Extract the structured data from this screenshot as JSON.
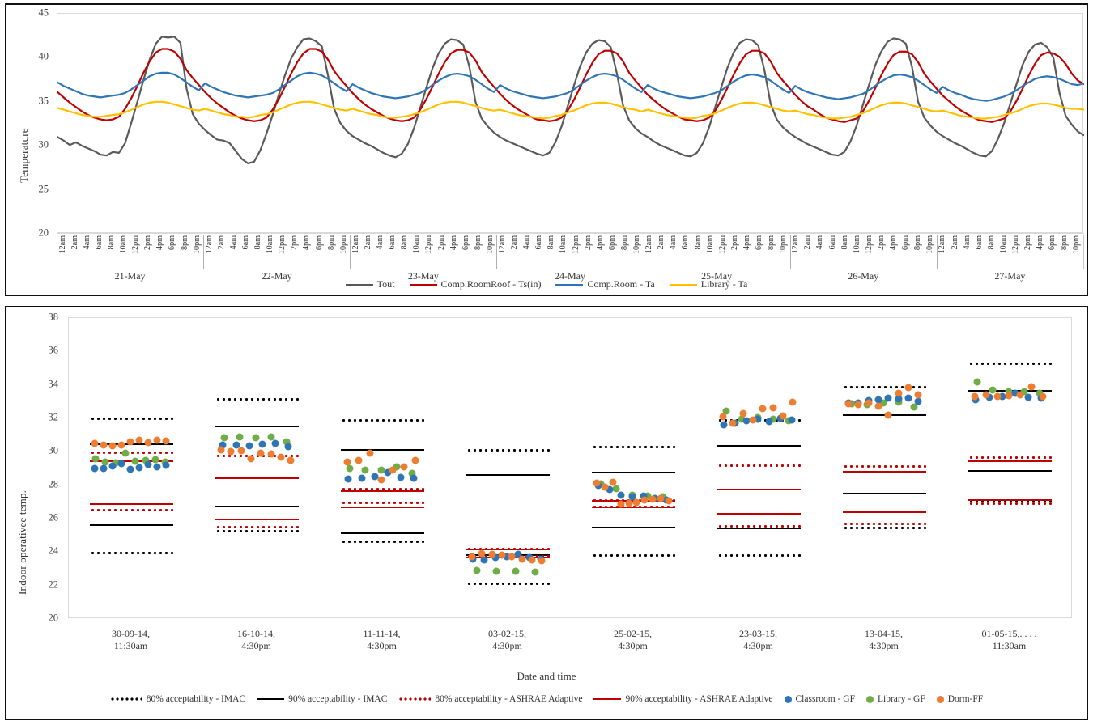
{
  "colors": {
    "tout": "#595959",
    "comp_roomroof": "#C00000",
    "comp_room": "#2E75B6",
    "library": "#FFC000",
    "classroom_gf": "#2E75B6",
    "library_gf": "#70AD47",
    "dorm_ff": "#ED7D31",
    "imac_black": "#000000",
    "ashrae_red": "#C00000",
    "axis": "#d9d9d9"
  },
  "top_chart": {
    "type": "line",
    "ylabel": "Temperature",
    "ylim": [
      20,
      45
    ],
    "yticks": [
      20,
      25,
      30,
      35,
      40,
      45
    ],
    "hour_labels": [
      "12am",
      "2am",
      "4am",
      "6am",
      "8am",
      "10am",
      "12pm",
      "2pm",
      "4pm",
      "6pm",
      "8pm",
      "10pm"
    ],
    "day_labels": [
      "21-May",
      "22-May",
      "23-May",
      "24-May",
      "25-May",
      "26-May",
      "27-May"
    ],
    "legend": [
      {
        "label": "Tout",
        "color": "#595959",
        "style": "solid"
      },
      {
        "label": "Comp.RoomRoof - Ts(in)",
        "color": "#C00000",
        "style": "solid"
      },
      {
        "label": "Comp.Room - Ta",
        "color": "#2E75B6",
        "style": "solid"
      },
      {
        "label": "Library - Ta",
        "color": "#FFC000",
        "style": "solid"
      }
    ],
    "series": [
      {
        "name": "Tout",
        "color": "#595959",
        "values": [
          31.0,
          30.6,
          30.1,
          30.4,
          30.0,
          29.7,
          29.4,
          29.0,
          28.9,
          29.3,
          29.2,
          30.3,
          32.6,
          35.0,
          37.5,
          39.8,
          41.6,
          42.4,
          42.3,
          42.4,
          41.7,
          36.5,
          33.6,
          32.5,
          31.8,
          31.2,
          30.7,
          30.6,
          30.3,
          29.4,
          28.5,
          28.0,
          28.2,
          29.5,
          31.4,
          33.5,
          35.8,
          38.0,
          39.9,
          41.2,
          42.1,
          42.2,
          41.9,
          41.3,
          38.0,
          34.2,
          32.6,
          31.7,
          31.1,
          30.7,
          30.3,
          30.0,
          29.6,
          29.2,
          28.9,
          28.7,
          29.1,
          30.2,
          32.0,
          34.3,
          36.6,
          38.8,
          40.5,
          41.6,
          42.1,
          42.0,
          41.5,
          39.0,
          35.0,
          33.1,
          32.2,
          31.5,
          31.0,
          30.6,
          30.3,
          30.0,
          29.7,
          29.4,
          29.1,
          28.9,
          29.2,
          30.4,
          32.2,
          34.5,
          36.8,
          39.0,
          40.6,
          41.6,
          42.0,
          41.9,
          41.2,
          38.2,
          34.6,
          32.9,
          32.0,
          31.4,
          31.0,
          30.5,
          30.1,
          29.8,
          29.5,
          29.2,
          28.9,
          28.8,
          29.2,
          30.3,
          32.1,
          34.4,
          36.7,
          38.9,
          40.6,
          41.7,
          42.1,
          42.0,
          41.4,
          38.6,
          34.8,
          33.0,
          32.1,
          31.5,
          31.0,
          30.6,
          30.2,
          29.9,
          29.6,
          29.3,
          29.0,
          28.9,
          29.3,
          30.5,
          32.3,
          34.6,
          36.9,
          39.1,
          40.7,
          41.8,
          42.2,
          42.1,
          41.6,
          39.0,
          35.0,
          33.2,
          32.3,
          31.6,
          31.1,
          30.7,
          30.3,
          30.0,
          29.6,
          29.2,
          28.9,
          28.8,
          29.4,
          30.8,
          32.6,
          34.8,
          37.0,
          39.2,
          40.7,
          41.5,
          41.7,
          41.2,
          40.0,
          36.0,
          33.4,
          32.4,
          31.6,
          31.2
        ]
      },
      {
        "name": "Comp.RoomRoof - Ts(in)",
        "color": "#C00000",
        "values": [
          36.1,
          35.5,
          34.9,
          34.4,
          33.9,
          33.5,
          33.2,
          33.0,
          32.9,
          33.0,
          33.3,
          34.2,
          35.4,
          36.8,
          38.3,
          39.6,
          40.6,
          41.0,
          41.0,
          40.7,
          39.9,
          38.6,
          37.7,
          36.9,
          36.1,
          35.4,
          34.8,
          34.3,
          33.8,
          33.4,
          33.1,
          32.9,
          32.8,
          32.9,
          33.2,
          34.1,
          35.3,
          36.7,
          38.2,
          39.5,
          40.5,
          41.0,
          41.0,
          40.7,
          39.8,
          38.5,
          37.6,
          36.8,
          36.0,
          35.3,
          34.7,
          34.2,
          33.8,
          33.4,
          33.1,
          32.9,
          32.8,
          32.9,
          33.2,
          34.1,
          35.3,
          36.7,
          38.2,
          39.5,
          40.5,
          40.9,
          40.9,
          40.6,
          39.7,
          38.4,
          37.5,
          36.7,
          35.9,
          35.2,
          34.6,
          34.1,
          33.7,
          33.3,
          33.0,
          32.9,
          32.8,
          32.9,
          33.2,
          34.0,
          35.2,
          36.6,
          38.1,
          39.4,
          40.4,
          40.8,
          40.8,
          40.5,
          39.6,
          38.3,
          37.4,
          36.6,
          35.8,
          35.2,
          34.6,
          34.1,
          33.7,
          33.3,
          33.0,
          32.9,
          32.8,
          32.9,
          33.2,
          34.0,
          35.2,
          36.6,
          38.1,
          39.4,
          40.4,
          40.8,
          40.8,
          40.5,
          39.6,
          38.3,
          37.4,
          36.6,
          35.8,
          35.1,
          34.5,
          34.1,
          33.6,
          33.2,
          33.0,
          32.8,
          32.7,
          32.9,
          33.1,
          33.9,
          35.1,
          36.5,
          38.0,
          39.3,
          40.3,
          40.7,
          40.7,
          40.4,
          39.5,
          38.2,
          37.3,
          36.5,
          35.7,
          35.1,
          34.5,
          34.0,
          33.6,
          33.2,
          32.9,
          32.8,
          32.7,
          32.9,
          33.1,
          33.9,
          35.1,
          36.5,
          38.0,
          39.3,
          40.3,
          40.6,
          40.5,
          40.1,
          39.3,
          38.2,
          37.4,
          37.0
        ]
      },
      {
        "name": "Comp.Room - Ta",
        "color": "#2E75B6",
        "values": [
          37.2,
          36.8,
          36.5,
          36.2,
          35.9,
          35.7,
          35.6,
          35.5,
          35.6,
          35.7,
          35.8,
          36.0,
          36.4,
          36.9,
          37.4,
          37.9,
          38.2,
          38.3,
          38.3,
          38.1,
          37.7,
          37.2,
          36.7,
          36.3,
          37.1,
          36.7,
          36.4,
          36.1,
          35.9,
          35.7,
          35.6,
          35.5,
          35.6,
          35.7,
          35.8,
          36.0,
          36.4,
          36.9,
          37.4,
          37.9,
          38.2,
          38.3,
          38.2,
          38.0,
          37.6,
          37.1,
          36.6,
          36.2,
          37.0,
          36.6,
          36.3,
          36.0,
          35.8,
          35.6,
          35.5,
          35.4,
          35.5,
          35.6,
          35.8,
          36.0,
          36.4,
          36.9,
          37.4,
          37.8,
          38.1,
          38.2,
          38.1,
          37.9,
          37.5,
          37.0,
          36.5,
          36.1,
          36.9,
          36.5,
          36.2,
          36.0,
          35.8,
          35.6,
          35.5,
          35.4,
          35.5,
          35.6,
          35.8,
          36.0,
          36.4,
          36.9,
          37.4,
          37.8,
          38.1,
          38.2,
          38.1,
          37.9,
          37.5,
          37.0,
          36.5,
          36.1,
          36.9,
          36.5,
          36.2,
          36.0,
          35.8,
          35.6,
          35.5,
          35.4,
          35.5,
          35.6,
          35.8,
          36.0,
          36.3,
          36.8,
          37.3,
          37.7,
          38.0,
          38.1,
          38.0,
          37.8,
          37.4,
          36.9,
          36.4,
          36.0,
          36.8,
          36.4,
          36.1,
          35.9,
          35.7,
          35.5,
          35.4,
          35.3,
          35.4,
          35.5,
          35.7,
          35.9,
          36.3,
          36.8,
          37.3,
          37.7,
          38.0,
          38.1,
          38.0,
          37.8,
          37.4,
          36.9,
          36.4,
          36.0,
          36.7,
          36.3,
          36.0,
          35.8,
          35.5,
          35.3,
          35.2,
          35.1,
          35.2,
          35.4,
          35.6,
          35.9,
          36.3,
          36.8,
          37.2,
          37.6,
          37.8,
          37.9,
          37.8,
          37.6,
          37.3,
          37.0,
          36.9,
          37.1
        ]
      },
      {
        "name": "Library - Ta",
        "color": "#FFC000",
        "values": [
          34.3,
          34.1,
          33.9,
          33.7,
          33.5,
          33.4,
          33.3,
          33.3,
          33.4,
          33.5,
          33.6,
          33.8,
          34.1,
          34.4,
          34.7,
          34.9,
          35.0,
          35.0,
          34.9,
          34.7,
          34.5,
          34.3,
          34.1,
          34.0,
          34.2,
          34.0,
          33.8,
          33.6,
          33.5,
          33.3,
          33.3,
          33.2,
          33.3,
          33.5,
          33.6,
          33.8,
          34.1,
          34.4,
          34.7,
          34.9,
          35.0,
          35.0,
          34.9,
          34.7,
          34.5,
          34.3,
          34.1,
          34.0,
          34.2,
          34.0,
          33.8,
          33.6,
          33.5,
          33.3,
          33.2,
          33.2,
          33.3,
          33.4,
          33.6,
          33.8,
          34.1,
          34.4,
          34.7,
          34.9,
          35.0,
          35.0,
          34.9,
          34.7,
          34.5,
          34.3,
          34.1,
          34.0,
          34.1,
          33.9,
          33.7,
          33.5,
          33.4,
          33.3,
          33.2,
          33.1,
          33.2,
          33.4,
          33.5,
          33.8,
          34.0,
          34.3,
          34.6,
          34.8,
          34.9,
          34.9,
          34.8,
          34.6,
          34.4,
          34.2,
          34.1,
          33.9,
          34.1,
          33.9,
          33.7,
          33.5,
          33.4,
          33.3,
          33.2,
          33.1,
          33.2,
          33.4,
          33.5,
          33.7,
          34.0,
          34.3,
          34.6,
          34.8,
          34.9,
          34.9,
          34.8,
          34.6,
          34.4,
          34.2,
          34.0,
          33.9,
          34.0,
          33.8,
          33.6,
          33.5,
          33.3,
          33.2,
          33.1,
          33.1,
          33.2,
          33.3,
          33.5,
          33.7,
          34.0,
          34.3,
          34.6,
          34.8,
          34.9,
          34.9,
          34.8,
          34.6,
          34.4,
          34.2,
          34.0,
          33.9,
          34.0,
          33.8,
          33.6,
          33.4,
          33.3,
          33.2,
          33.1,
          33.1,
          33.2,
          33.3,
          33.5,
          33.7,
          33.9,
          34.2,
          34.5,
          34.7,
          34.8,
          34.8,
          34.7,
          34.5,
          34.3,
          34.2,
          34.2,
          34.1
        ]
      }
    ]
  },
  "bottom_chart": {
    "type": "scatter",
    "ylabel": "Indoor operativee temp.",
    "xlabel": "Date and time",
    "ylim": [
      20,
      38
    ],
    "yticks": [
      20,
      22,
      24,
      26,
      28,
      30,
      32,
      34,
      36,
      38
    ],
    "categories": [
      {
        "date": "30-09-14,",
        "time": "11:30am"
      },
      {
        "date": "16-10-14,",
        "time": "4:30pm"
      },
      {
        "date": "11-11-14,",
        "time": "4:30pm"
      },
      {
        "date": "03-02-15,",
        "time": "4:30pm"
      },
      {
        "date": "25-02-15,",
        "time": "4:30pm"
      },
      {
        "date": "23-03-15,",
        "time": "4:30pm"
      },
      {
        "date": "13-04-15,",
        "time": "4:30pm"
      },
      {
        "date": "01-05-15,. . . .",
        "time": "11:30am"
      }
    ],
    "legend": [
      {
        "label": "80% acceptability - IMAC",
        "color": "#000000",
        "style": "dotted"
      },
      {
        "label": "90% acceptability - IMAC",
        "color": "#000000",
        "style": "solid"
      },
      {
        "label": "80% acceptability - ASHRAE Adaptive",
        "color": "#C00000",
        "style": "dotted"
      },
      {
        "label": "90% acceptability - ASHRAE Adaptive",
        "color": "#C00000",
        "style": "solid"
      },
      {
        "label": "Classroom - GF",
        "color": "#2E75B6",
        "style": "dot"
      },
      {
        "label": "Library - GF",
        "color": "#70AD47",
        "style": "dot"
      },
      {
        "label": "Dorm-FF",
        "color": "#ED7D31",
        "style": "dot"
      }
    ],
    "groups": [
      {
        "imac_80": [
          23.95,
          32.0
        ],
        "imac_90": [
          25.6,
          30.45
        ],
        "ashrae_80": [
          26.5,
          29.95
        ],
        "ashrae_90": [
          26.85,
          29.4
        ],
        "classroom": [
          29.0,
          29.0,
          29.15,
          29.3,
          28.95,
          29.05,
          29.25,
          29.1,
          29.2
        ],
        "library": [
          29.6,
          29.4,
          29.35,
          29.9,
          29.45,
          29.5,
          29.55,
          29.4
        ],
        "dorm": [
          30.5,
          30.4,
          30.35,
          30.4,
          30.6,
          30.7,
          30.55,
          30.7,
          30.65
        ]
      },
      {
        "imac_80": [
          25.25,
          33.15
        ],
        "imac_90": [
          26.7,
          31.5
        ],
        "ashrae_80": [
          25.5,
          29.75
        ],
        "ashrae_90": [
          25.95,
          28.4
        ],
        "classroom": [
          30.4,
          30.4,
          30.35,
          30.45,
          30.5,
          30.3
        ],
        "library": [
          30.85,
          30.9,
          30.85,
          30.9,
          30.6
        ],
        "dorm": [
          30.1,
          30.0,
          30.05,
          29.6,
          29.9,
          29.85,
          29.7,
          29.5
        ]
      },
      {
        "imac_80": [
          24.6,
          31.9
        ],
        "imac_90": [
          25.1,
          30.1
        ],
        "ashrae_80": [
          26.95,
          27.75
        ],
        "ashrae_90": [
          26.65,
          27.65
        ],
        "classroom": [
          28.35,
          28.4,
          28.5,
          28.75,
          28.45,
          28.4
        ],
        "library": [
          29.0,
          28.9,
          28.9,
          29.1,
          28.7
        ],
        "dorm": [
          29.4,
          29.5,
          29.9,
          28.3,
          28.9,
          29.1,
          29.5
        ]
      },
      {
        "imac_80": [
          22.1,
          30.1
        ],
        "imac_90": [
          23.8,
          28.6
        ],
        "ashrae_80": [
          23.75,
          24.2
        ],
        "ashrae_90": [
          23.65,
          24.15
        ],
        "classroom": [
          23.6,
          23.55,
          23.7,
          23.75,
          23.85,
          23.7,
          23.6
        ],
        "library": [
          22.9,
          22.85,
          22.85,
          22.8
        ],
        "dorm": [
          23.75,
          23.9,
          23.85,
          23.8,
          23.75,
          23.6,
          23.55,
          23.5
        ]
      },
      {
        "imac_80": [
          23.8,
          30.3
        ],
        "imac_90": [
          25.45,
          28.75
        ],
        "ashrae_80": [
          26.7,
          27.1
        ],
        "ashrae_90": [
          26.65,
          27.05
        ],
        "classroom": [
          28.0,
          27.75,
          27.4,
          27.3,
          27.35,
          27.2,
          27.1
        ],
        "library": [
          28.1,
          27.8,
          27.4,
          27.35,
          27.3
        ],
        "dorm": [
          28.15,
          27.9,
          28.2,
          26.85,
          26.9,
          26.95,
          27.1,
          27.15,
          27.2,
          27.05
        ]
      },
      {
        "imac_80": [
          23.8,
          31.9
        ],
        "imac_90": [
          25.4,
          30.35
        ],
        "ashrae_80": [
          25.55,
          29.15
        ],
        "ashrae_90": [
          26.3,
          27.75
        ],
        "classroom": [
          31.6,
          31.7,
          31.85,
          31.95,
          31.8,
          32.0,
          31.9
        ],
        "library": [
          32.45,
          31.95,
          32.05,
          31.95,
          31.85
        ],
        "dorm": [
          32.1,
          31.7,
          32.3,
          31.9,
          32.6,
          32.65,
          32.15,
          32.95
        ]
      },
      {
        "imac_80": [
          25.45,
          33.85
        ],
        "imac_90": [
          27.5,
          32.2
        ],
        "ashrae_80": [
          25.7,
          29.1
        ],
        "ashrae_90": [
          26.35,
          28.8
        ],
        "classroom": [
          32.9,
          32.9,
          33.05,
          33.1,
          33.2,
          33.15,
          33.2,
          33.0
        ],
        "library": [
          32.85,
          32.8,
          32.9,
          32.95,
          32.7
        ],
        "dorm": [
          32.85,
          32.8,
          32.9,
          32.75,
          32.2,
          33.5,
          33.85,
          33.4
        ]
      },
      {
        "imac_80": [
          27.05,
          35.25
        ],
        "imac_90": [
          28.85,
          33.65
        ],
        "ashrae_80": [
          26.9,
          29.65
        ],
        "ashrae_90": [
          27.1,
          29.4
        ],
        "classroom": [
          33.1,
          33.25,
          33.3,
          33.5,
          33.25,
          33.2
        ],
        "library": [
          34.2,
          33.7,
          33.6,
          33.6,
          33.5
        ],
        "dorm": [
          33.3,
          33.4,
          33.3,
          33.35,
          33.4,
          33.9,
          33.3
        ]
      }
    ]
  }
}
